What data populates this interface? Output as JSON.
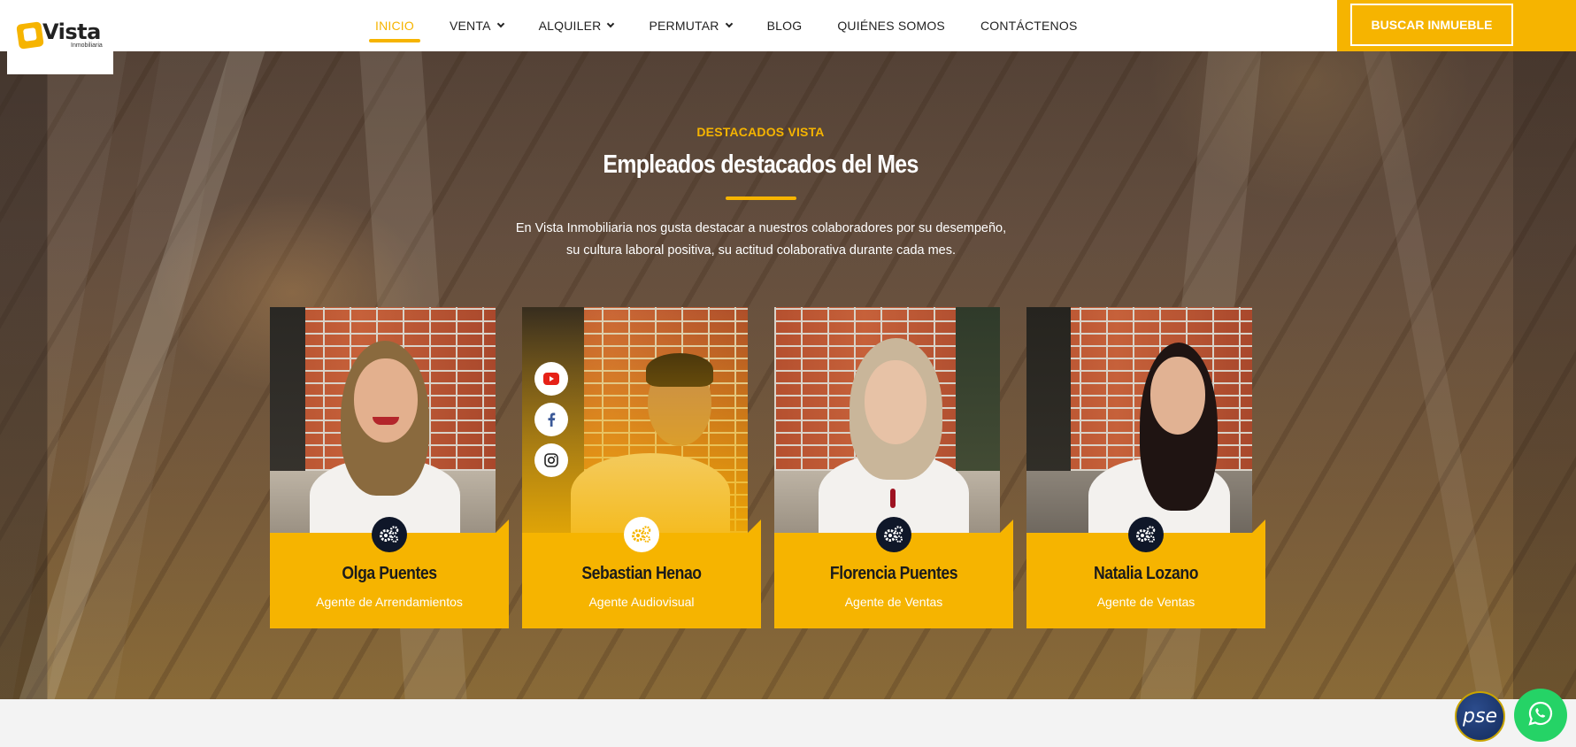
{
  "brand": {
    "name": "Vista",
    "sub": "Inmobiliaria"
  },
  "nav": {
    "items": [
      {
        "label": "INICIO",
        "active": true,
        "dropdown": false
      },
      {
        "label": "VENTA",
        "active": false,
        "dropdown": true
      },
      {
        "label": "ALQUILER",
        "active": false,
        "dropdown": true
      },
      {
        "label": "PERMUTAR",
        "active": false,
        "dropdown": true
      },
      {
        "label": "BLOG",
        "active": false,
        "dropdown": false
      },
      {
        "label": "QUIÉNES SOMOS",
        "active": false,
        "dropdown": false
      },
      {
        "label": "CONTÁCTENOS",
        "active": false,
        "dropdown": false
      }
    ],
    "cta": "BUSCAR INMUEBLE"
  },
  "section": {
    "eyebrow": "DESTACADOS VISTA",
    "title": "Empleados destacados del Mes",
    "intro": "En Vista Inmobiliaria nos gusta destacar a nuestros colaboradores por su desempeño, su cultura laboral positiva, su actitud colaborativa durante cada mes."
  },
  "employees": [
    {
      "name": "Olga Puentes",
      "role": "Agente de Arrendamientos",
      "icon": "gears-icon"
    },
    {
      "name": "Sebastian Henao",
      "role": "Agente Audiovisual",
      "icon": "gears-icon",
      "hover": true,
      "social": [
        "youtube-icon",
        "facebook-icon",
        "instagram-icon"
      ]
    },
    {
      "name": "Florencia Puentes",
      "role": "Agente de Ventas",
      "icon": "gears-icon"
    },
    {
      "name": "Natalia Lozano",
      "role": "Agente de Ventas",
      "icon": "gears-icon"
    }
  ],
  "floating": {
    "pse_label": "pse",
    "whatsapp_icon": "whatsapp-icon"
  },
  "colors": {
    "accent": "#f6b400",
    "dark": "#0f1729",
    "whatsapp": "#25d366"
  }
}
